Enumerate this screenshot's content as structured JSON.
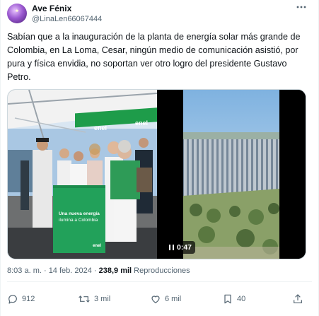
{
  "author": {
    "name": "Ave Fénix",
    "handle": "@LinaLen66067444"
  },
  "tweet": {
    "text": "Sabían que a la inauguración de la planta de energía solar más grande de Colombia, en La Loma, Cesar, ningún medio de comunicación asistió, por pura y física envidia, no soportan ver otro logro del presidente Gustavo Petro."
  },
  "media": {
    "left_image": {
      "banner_brand": "enel",
      "sign_line1": "Una nueva energía",
      "sign_line2": "ilumina a Colombia",
      "sign_brand": "enel"
    },
    "video": {
      "duration": "0:47"
    }
  },
  "meta": {
    "time": "8:03 a. m. · 14 feb. 2024 · ",
    "views_count": "238,9 mil",
    "views_label": " Reproducciones"
  },
  "actions": {
    "reply_count": "912",
    "retweet_count": "3 mil",
    "like_count": "6 mil",
    "bookmark_count": "40"
  },
  "colors": {
    "text_primary": "#0f1419",
    "text_secondary": "#536471",
    "enel_green": "#1e9c4a"
  }
}
